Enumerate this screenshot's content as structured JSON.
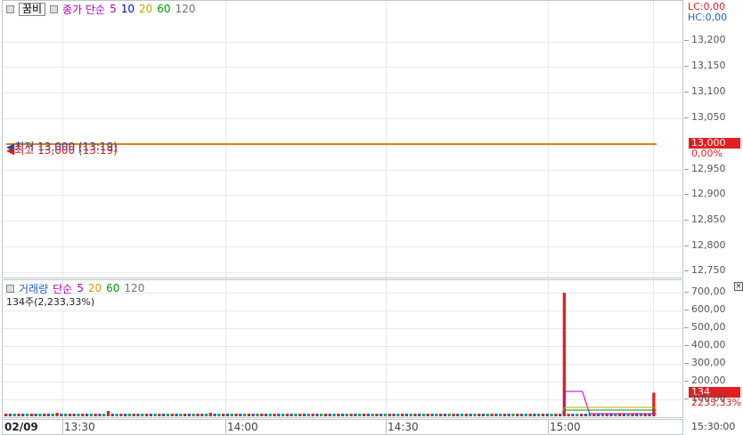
{
  "price_panel": {
    "legend": {
      "tag": "꿈비",
      "ma_label": "종가 단순",
      "periods": [
        "5",
        "10",
        "20",
        "60",
        "120"
      ]
    },
    "low_price": "최저 13,000 (13:19)",
    "high_price": "최고 13,000 (13:19)",
    "lc": "LC:0,00",
    "hc": "HC:0,00",
    "current_price": "13,000",
    "change_pct": "0,00%",
    "y_ticks": [
      "13,200",
      "13,150",
      "13,100",
      "13,050",
      "12,950",
      "12,900",
      "12,850",
      "12,800",
      "12,750"
    ],
    "price_line_value": 13000
  },
  "volume_panel": {
    "legend": {
      "label": "거래량",
      "ma_label": "단순",
      "periods": [
        "5",
        "20",
        "60",
        "120"
      ]
    },
    "summary": "134주(2,233,33%)",
    "current_volume": "134",
    "volume_pct": "2233,33%",
    "y_ticks": [
      "700,00",
      "600,00",
      "500,00",
      "400,00",
      "300,00",
      "200,00",
      "100,00"
    ],
    "close_icon": "close-icon"
  },
  "x_axis": {
    "date": "02/09",
    "ticks": [
      "13:30",
      "14:00",
      "14:30",
      "15:00"
    ],
    "end_time": "15:30:00"
  },
  "colors": {
    "ma5": "#b400b4",
    "ma10": "#0000c8",
    "ma20": "#c8a000",
    "ma60": "#009600",
    "ma120": "#707070",
    "up": "#e02020",
    "down": "#2060c0",
    "lc": "#e02020",
    "hc": "#2060c0"
  },
  "chart_data": {
    "type": "bar",
    "title": "",
    "ylabel": "",
    "ylim": [
      0,
      700
    ],
    "series": [
      {
        "values": [
          15,
          15,
          15,
          15,
          15,
          15,
          15,
          15,
          15,
          15,
          15,
          15,
          20,
          15,
          15,
          15,
          15,
          15,
          15,
          15,
          15,
          15,
          15,
          15,
          30,
          15,
          15,
          15,
          15,
          15,
          15,
          15,
          15,
          15,
          15,
          15,
          15,
          15,
          15,
          15,
          15,
          15,
          15,
          15,
          15,
          15,
          15,
          15,
          20,
          15,
          15,
          15,
          15,
          15,
          15,
          15,
          15,
          15,
          15,
          15,
          15,
          15,
          15,
          15,
          15,
          15,
          15,
          15,
          15,
          15,
          15,
          15,
          15,
          15,
          15,
          15,
          15,
          15,
          15,
          15,
          15,
          15,
          15,
          15,
          15,
          15,
          15,
          15,
          15,
          15,
          15,
          15,
          15,
          15,
          15,
          15,
          15,
          15,
          15,
          15,
          15,
          15,
          15,
          15,
          15,
          15,
          15,
          15,
          15,
          15,
          15,
          15,
          15,
          15,
          15,
          15,
          15,
          15,
          15,
          15,
          15,
          15,
          15,
          15,
          15,
          15,
          15,
          15,
          15,
          15,
          15,
          700,
          15,
          15,
          15,
          15,
          15,
          15,
          15,
          15,
          15,
          15,
          15,
          15,
          15,
          15,
          15,
          15,
          15,
          15,
          15,
          15,
          134
        ]
      }
    ]
  }
}
